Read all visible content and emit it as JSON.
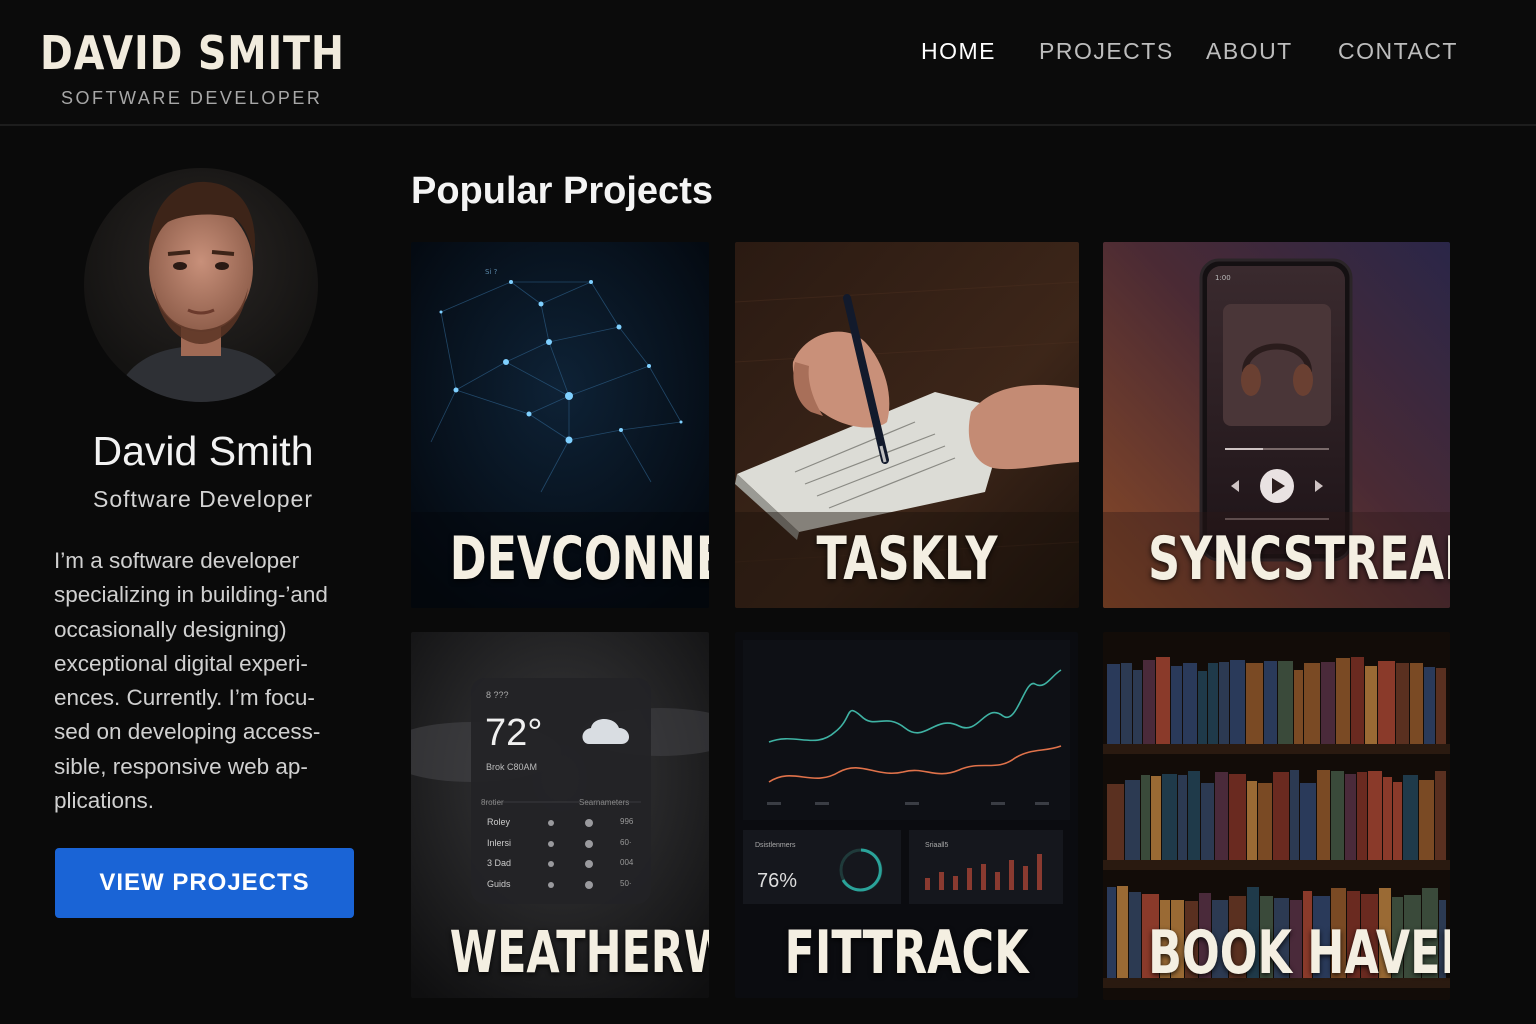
{
  "header": {
    "brand_name": "DAVID SMITH",
    "brand_subtitle": "SOFTWARE DEVELOPER",
    "nav": [
      {
        "label": "HOME",
        "active": true
      },
      {
        "label": "PROJECTS",
        "active": false
      },
      {
        "label": "ABOUT",
        "active": false
      },
      {
        "label": "CONTACT",
        "active": false
      }
    ]
  },
  "profile": {
    "name": "David Smith",
    "role": "Software Developer",
    "bio_lines": [
      "I’m a software developer",
      "specializing in building-’and",
      "occasionally designing)",
      "exceptional digital experi-",
      "ences. Currently. I’m focu-",
      "sed on developing access-",
      "sible, responsive web ap-",
      "plications."
    ],
    "cta_label": "VIEW PROJECTS"
  },
  "projects_section": {
    "title": "Popular Projects",
    "projects": [
      {
        "title": "DEVCONNECT"
      },
      {
        "title": "TASKLY"
      },
      {
        "title": "SYNCSTREAM"
      },
      {
        "title": "WEATHERWISE",
        "widget": {
          "temp": "72°",
          "subtitle": "Brok C80AM",
          "header": "8 ???",
          "table_left_header": "8rotier",
          "table_right_header": "Searnameters",
          "rows": [
            {
              "day": "Roley",
              "value": "996"
            },
            {
              "day": "Inlersi",
              "value": "60·"
            },
            {
              "day": "3 Dad",
              "value": "004"
            },
            {
              "day": "Guids",
              "value": "50·"
            }
          ]
        }
      },
      {
        "title": "FITTRACK",
        "widget": {
          "percent": "76%",
          "panel_left_label": "Dsistlenmers",
          "panel_right_label": "Sriaall5"
        }
      },
      {
        "title": "BOOK HAVEN"
      }
    ]
  },
  "colors": {
    "accent": "#1a64d6",
    "background": "#0a0a0a",
    "title_cream": "#f4efe2"
  }
}
